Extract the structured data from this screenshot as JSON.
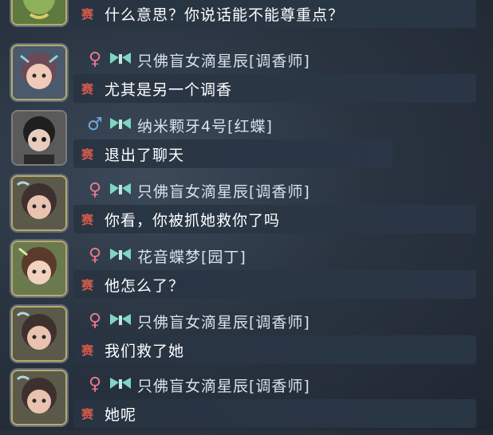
{
  "messages": [
    {
      "gender": "♀",
      "gender_type": "female",
      "name": "",
      "tag": "赛",
      "text": "什么意思？你说话能不能尊重点？"
    },
    {
      "gender": "♀",
      "gender_type": "female",
      "name": "只佛盲女滴星辰[调香师]",
      "tag": "赛",
      "text": "尤其是另一个调香"
    },
    {
      "gender": "♂",
      "gender_type": "male",
      "name": "纳米颗牙4号[红蝶]",
      "tag": "赛",
      "text": "退出了聊天"
    },
    {
      "gender": "♀",
      "gender_type": "female",
      "name": "只佛盲女滴星辰[调香师]",
      "tag": "赛",
      "text": "你看，你被抓她救你了吗"
    },
    {
      "gender": "♀",
      "gender_type": "female",
      "name": "花音蝶梦[园丁]",
      "tag": "赛",
      "text": "他怎么了？"
    },
    {
      "gender": "♀",
      "gender_type": "female",
      "name": "只佛盲女滴星辰[调香师]",
      "tag": "赛",
      "text": "我们救了她"
    },
    {
      "gender": "♀",
      "gender_type": "female",
      "name": "只佛盲女滴星辰[调香师]",
      "tag": "赛",
      "text": "她呢"
    }
  ],
  "colors": {
    "female": "#e8788f",
    "male": "#6fa9d9",
    "tag": "#d35a4a",
    "badge": "#7fd6c4"
  },
  "icons": {
    "badge": "butterfly-wing-badge-icon",
    "female": "female-symbol-icon",
    "male": "male-symbol-icon"
  }
}
